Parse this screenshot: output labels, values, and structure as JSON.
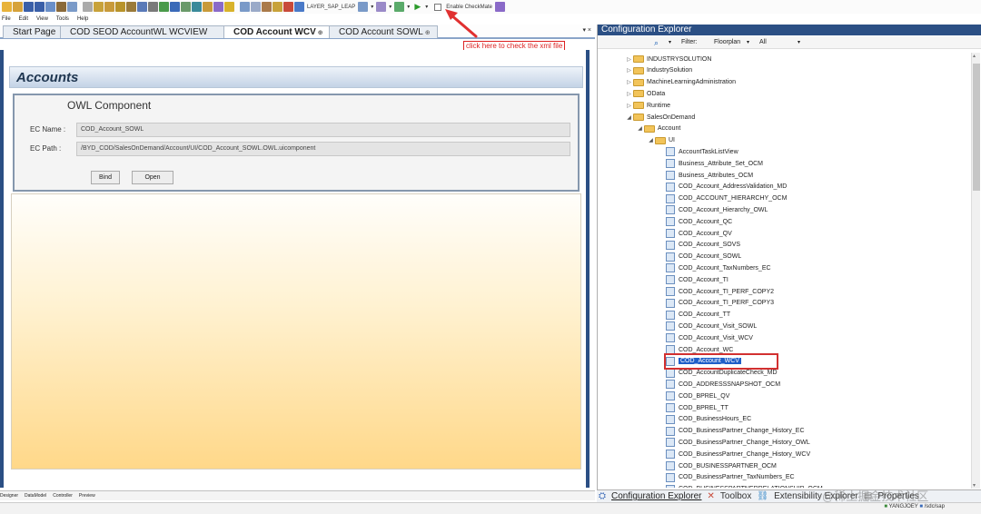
{
  "toolbar": {
    "layer_label": "LAYER_SAP_LEAP",
    "checkmate_label": "Enable CheckMate"
  },
  "menu": [
    "File",
    "Edit",
    "View",
    "Tools",
    "Help"
  ],
  "tabs": [
    {
      "label": "Start Page",
      "active": false
    },
    {
      "label": "COD SEOD AccountWL WCVIEW",
      "active": false
    },
    {
      "label": "COD Account WCV",
      "active": true
    },
    {
      "label": "COD Account SOWL",
      "active": false
    }
  ],
  "tab_controls": "▾ ×",
  "annotation": "click here to check the xml file",
  "designer": {
    "header": "Accounts",
    "component_title": "OWL Component",
    "ec_name_label": "EC Name :",
    "ec_name_value": "COD_Account_SOWL",
    "ec_path_label": "EC Path :",
    "ec_path_value": "/BYD_COD/SalesOnDemand/Account/UI/COD_Account_SOWL.OWL.uicomponent",
    "bind_button": "Bind",
    "open_button": "Open"
  },
  "bottom_tabs": [
    "Designer",
    "DataModel",
    "Controller",
    "Preview"
  ],
  "config_explorer": {
    "title": "Configuration Explorer",
    "filter_label": "Filter:",
    "filter_value": "Floorplan",
    "filter_scope": "All",
    "tree": [
      {
        "label": "INDUSTRYSOLUTION",
        "level": 0,
        "type": "folder",
        "exp": "▷"
      },
      {
        "label": "IndustrySolution",
        "level": 0,
        "type": "folder",
        "exp": "▷"
      },
      {
        "label": "MachineLearningAdministration",
        "level": 0,
        "type": "folder",
        "exp": "▷"
      },
      {
        "label": "OData",
        "level": 0,
        "type": "folder",
        "exp": "▷"
      },
      {
        "label": "Runtime",
        "level": 0,
        "type": "folder",
        "exp": "▷"
      },
      {
        "label": "SalesOnDemand",
        "level": 0,
        "type": "folder",
        "exp": "◢"
      },
      {
        "label": "Account",
        "level": 1,
        "type": "folder",
        "exp": "◢"
      },
      {
        "label": "UI",
        "level": 2,
        "type": "folder",
        "exp": "◢"
      },
      {
        "label": "AccountTaskListView",
        "level": 3,
        "type": "file"
      },
      {
        "label": "Business_Attribute_Set_OCM",
        "level": 3,
        "type": "file"
      },
      {
        "label": "Business_Attributes_OCM",
        "level": 3,
        "type": "file"
      },
      {
        "label": "COD_Account_AddressValidation_MD",
        "level": 3,
        "type": "file"
      },
      {
        "label": "COD_ACCOUNT_HIERARCHY_OCM",
        "level": 3,
        "type": "file"
      },
      {
        "label": "COD_Account_Hierarchy_OWL",
        "level": 3,
        "type": "file"
      },
      {
        "label": "COD_Account_QC",
        "level": 3,
        "type": "file"
      },
      {
        "label": "COD_Account_QV",
        "level": 3,
        "type": "file"
      },
      {
        "label": "COD_Account_SOVS",
        "level": 3,
        "type": "file"
      },
      {
        "label": "COD_Account_SOWL",
        "level": 3,
        "type": "file"
      },
      {
        "label": "COD_Account_TaxNumbers_EC",
        "level": 3,
        "type": "file"
      },
      {
        "label": "COD_Account_TI",
        "level": 3,
        "type": "file"
      },
      {
        "label": "COD_Account_TI_PERF_COPY2",
        "level": 3,
        "type": "file"
      },
      {
        "label": "COD_Account_TI_PERF_COPY3",
        "level": 3,
        "type": "file"
      },
      {
        "label": "COD_Account_TT",
        "level": 3,
        "type": "file"
      },
      {
        "label": "COD_Account_Visit_SOWL",
        "level": 3,
        "type": "file"
      },
      {
        "label": "COD_Account_Visit_WCV",
        "level": 3,
        "type": "file"
      },
      {
        "label": "COD_Account_WC",
        "level": 3,
        "type": "file"
      },
      {
        "label": "COD_Account_WCV",
        "level": 3,
        "type": "file",
        "selected": true
      },
      {
        "label": "COD_AccountDuplicateCheck_MD",
        "level": 3,
        "type": "file"
      },
      {
        "label": "COD_ADDRESSSNAPSHOT_OCM",
        "level": 3,
        "type": "file"
      },
      {
        "label": "COD_BPREL_QV",
        "level": 3,
        "type": "file"
      },
      {
        "label": "COD_BPREL_TT",
        "level": 3,
        "type": "file"
      },
      {
        "label": "COD_BusinessHours_EC",
        "level": 3,
        "type": "file"
      },
      {
        "label": "COD_BusinessPartner_Change_History_EC",
        "level": 3,
        "type": "file"
      },
      {
        "label": "COD_BusinessPartner_Change_History_OWL",
        "level": 3,
        "type": "file"
      },
      {
        "label": "COD_BusinessPartner_Change_History_WCV",
        "level": 3,
        "type": "file"
      },
      {
        "label": "COD_BUSINESSPARTNER_OCM",
        "level": 3,
        "type": "file"
      },
      {
        "label": "COD_BusinessPartner_TaxNumbers_EC",
        "level": 3,
        "type": "file"
      },
      {
        "label": "COD_BUSINESSPARTNERRELATIONSHIP_OCM",
        "level": 3,
        "type": "file"
      }
    ],
    "bottom_tabs": [
      "Configuration Explorer",
      "Toolbox",
      "Extensibility Explorer",
      "Properties"
    ]
  },
  "status": {
    "user": "YANGJOEY",
    "path": "/sdc/sap"
  },
  "watermark": "@稀土掘金技术社区"
}
